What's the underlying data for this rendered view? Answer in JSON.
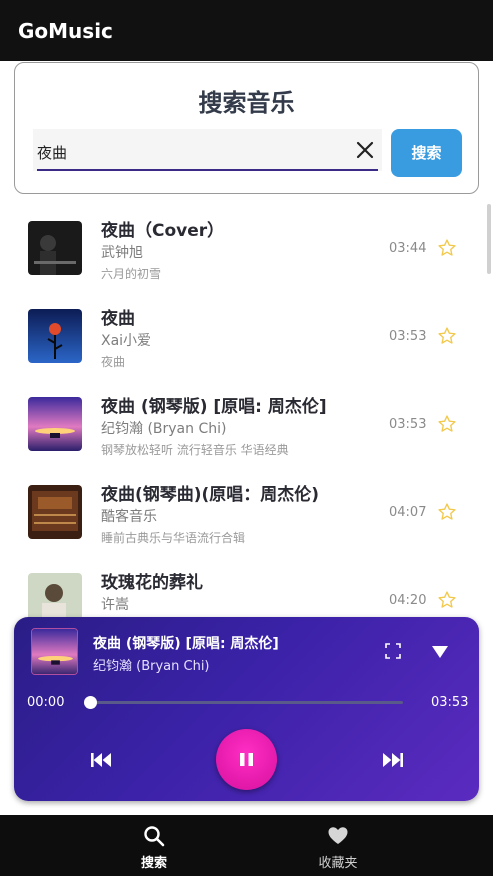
{
  "app": {
    "title": "GoMusic"
  },
  "search": {
    "title": "搜索音乐",
    "query": "夜曲",
    "button_label": "搜索"
  },
  "results": [
    {
      "title": "夜曲（Cover）",
      "artist": "武钟旭",
      "album": "六月的初雪",
      "duration": "03:44",
      "favorite": false
    },
    {
      "title": "夜曲",
      "artist": "Xai小爱",
      "album": "夜曲",
      "duration": "03:53",
      "favorite": false
    },
    {
      "title": "夜曲 (钢琴版) [原唱: 周杰伦]",
      "artist": "纪钧瀚 (Bryan Chi)",
      "album": "钢琴放松轻听 流行轻音乐 华语经典",
      "duration": "03:53",
      "favorite": false
    },
    {
      "title": "夜曲(钢琴曲)(原唱：周杰伦)",
      "artist": "酷客音乐",
      "album": "睡前古典乐与华语流行合辑",
      "duration": "04:07",
      "favorite": false
    },
    {
      "title": "玫瑰花的葬礼",
      "artist": "许嵩",
      "album": "",
      "duration": "04:20",
      "favorite": false
    }
  ],
  "player": {
    "title": "夜曲 (钢琴版) [原唱: 周杰伦]",
    "artist": "纪钧瀚 (Bryan Chi)",
    "current_time": "00:00",
    "total_time": "03:53",
    "progress": 0.0,
    "state": "playing"
  },
  "bottom_nav": [
    {
      "label": "搜索",
      "icon": "search-icon",
      "active": true
    },
    {
      "label": "收藏夹",
      "icon": "heart-icon",
      "active": false
    }
  ],
  "colors": {
    "accent": "#3a9ce0",
    "star": "#f2c94c",
    "player_bg": "#3b22a8",
    "play_button": "#e61aae"
  }
}
